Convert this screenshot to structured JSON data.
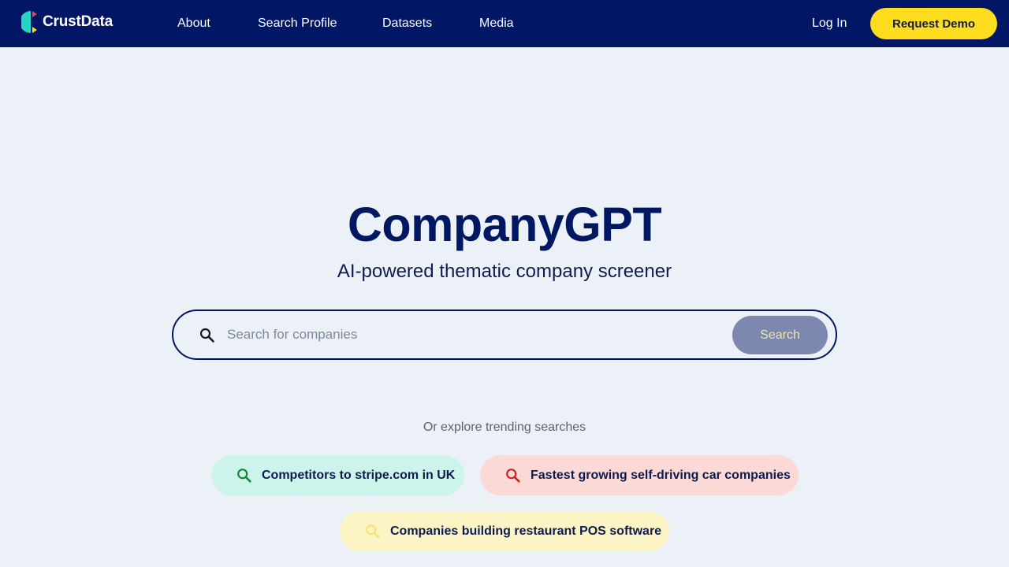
{
  "navbar": {
    "brand": "CrustData",
    "links": [
      {
        "label": "About"
      },
      {
        "label": "Search Profile"
      },
      {
        "label": "Datasets"
      },
      {
        "label": "Media"
      }
    ],
    "login_label": "Log In",
    "demo_label": "Request Demo"
  },
  "hero": {
    "title": "CompanyGPT",
    "subtitle": "AI-powered thematic company screener"
  },
  "search": {
    "placeholder": "Search for companies",
    "value": "",
    "button_label": "Search"
  },
  "trending": {
    "label": "Or explore trending searches",
    "items": [
      {
        "label": "Competitors to stripe.com in UK",
        "color": "#cdf4eb",
        "icon": "search-icon",
        "icon_color": "#15873a"
      },
      {
        "label": "Fastest growing self-driving car companies",
        "color": "#fbd9d7",
        "icon": "search-icon",
        "icon_color": "#c8231f"
      },
      {
        "label": "Companies building restaurant POS software",
        "color": "#fdf4c5",
        "icon": "search-icon",
        "icon_color": "#f5e27a"
      }
    ]
  },
  "colors": {
    "navy": "#011766",
    "background": "#ecf1f7",
    "accent_yellow": "#fddd1e"
  }
}
